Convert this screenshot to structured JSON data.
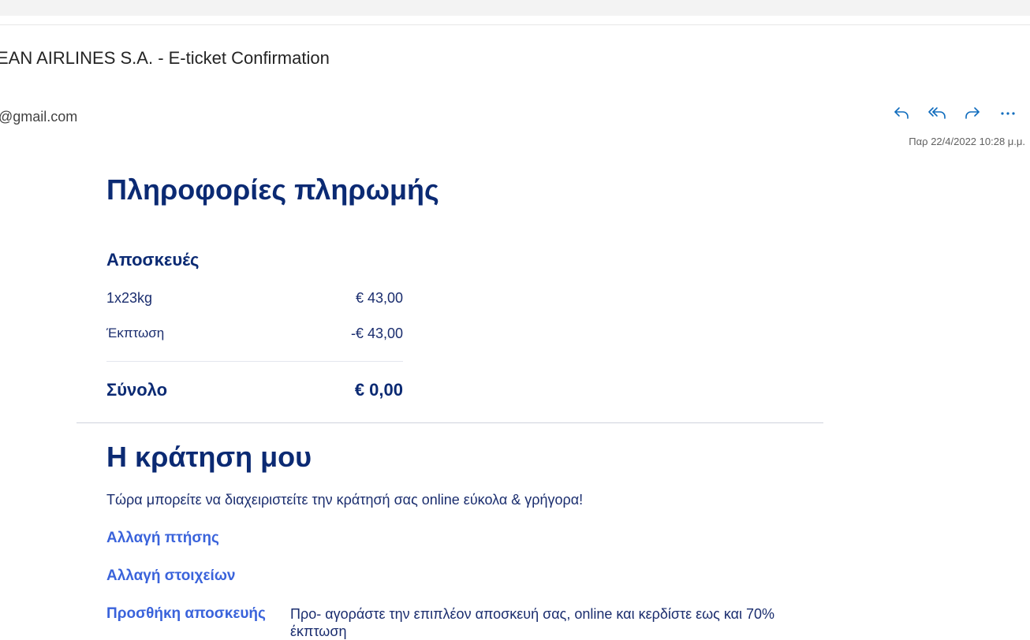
{
  "email": {
    "subject": "EAN AIRLINES S.A. - E-ticket Confirmation",
    "sender": "@gmail.com",
    "timestamp": "Παρ 22/4/2022 10:28 μ.μ.",
    "actions": [
      {
        "icon": "reply-icon"
      },
      {
        "icon": "reply-all-icon"
      },
      {
        "icon": "forward-icon"
      },
      {
        "icon": "more-icon"
      }
    ],
    "accent_color": "#0f6cbd"
  },
  "payment": {
    "title": "Πληροφορίες πληρωμής",
    "baggage_title": "Αποσκευές",
    "items": [
      {
        "label": "1x23kg",
        "amount": "€ 43,00"
      },
      {
        "label": "Έκπτωση",
        "amount": "-€ 43,00"
      }
    ],
    "total_label": "Σύνολο",
    "total_amount": "€ 0,00"
  },
  "booking": {
    "title": "Η κράτηση μου",
    "intro": "Τώρα μπορείτε να διαχειριστείτε την κράτησή σας online εύκολα & γρήγορα!",
    "links": [
      {
        "label": "Αλλαγή πτήσης"
      },
      {
        "label": "Αλλαγή στοιχείων"
      },
      {
        "label": "Προσθήκη αποσκευής",
        "description": "Προ- αγοράστε την επιπλέον αποσκευή σας, online και κερδίστε εως και 70% έκπτωση"
      }
    ]
  },
  "colors": {
    "heading": "#0b2a73",
    "body_text": "#1a2d6e",
    "link": "#3a63db"
  }
}
